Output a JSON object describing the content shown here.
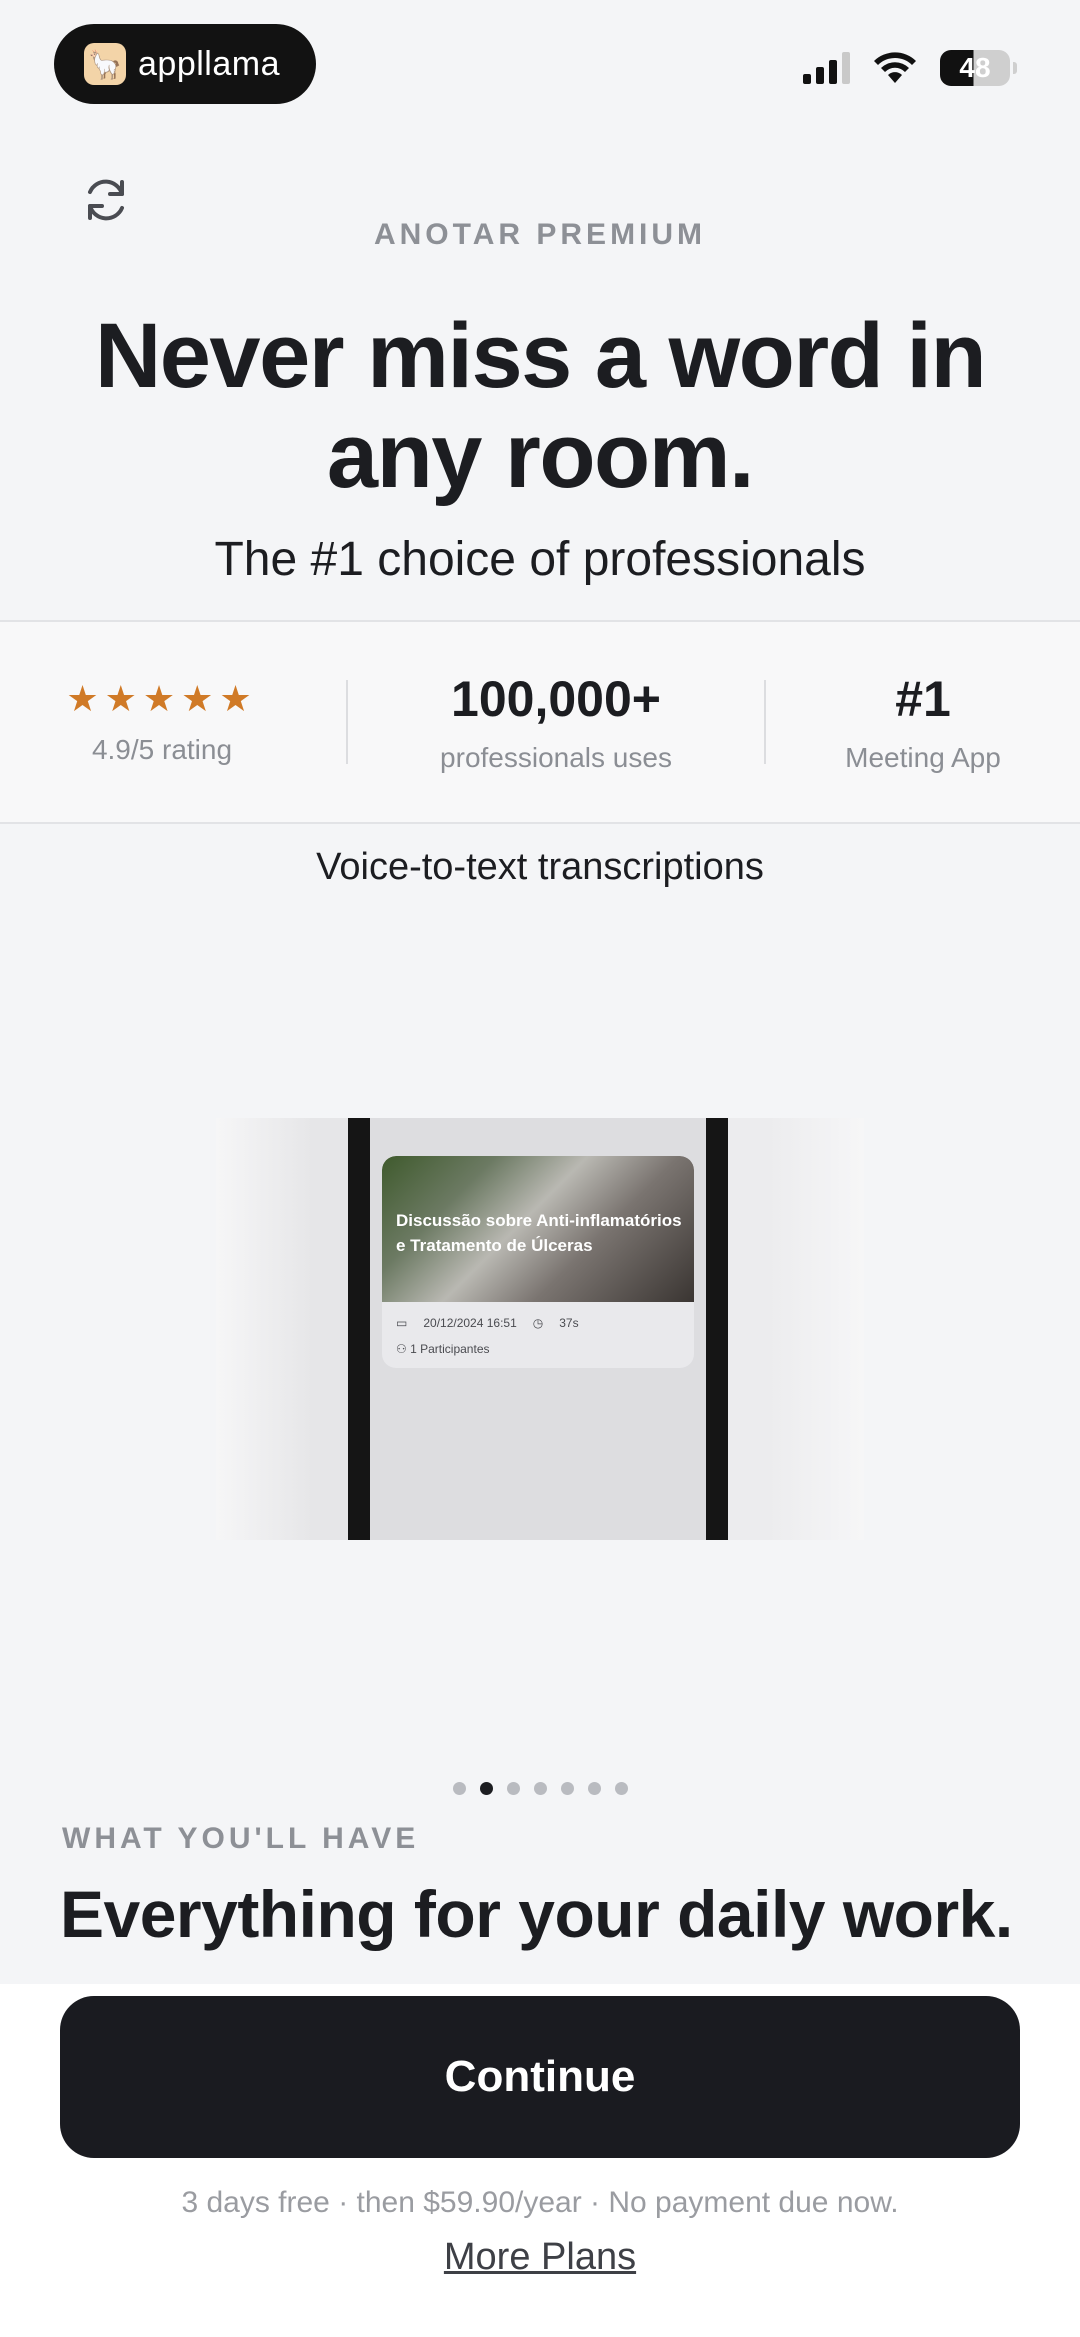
{
  "status_bar": {
    "brand_name": "appllama",
    "battery": "48",
    "icons": [
      "signal-icon",
      "wifi-icon",
      "battery-icon"
    ]
  },
  "header": {
    "restore_icon": "refresh-icon",
    "eyebrow": "ANOTAR PREMIUM",
    "headline": "Never miss a word in any room.",
    "subheadline": "The #1 choice of professionals"
  },
  "stats": {
    "rating_stars": "★★★★★",
    "rating_value": 4.9,
    "rating_label": "4.9/5 rating",
    "users_value": "100,000+",
    "users_label": "professionals uses",
    "rank_value": "#1",
    "rank_label": "Meeting App",
    "star_color": "#d07a27"
  },
  "feature": {
    "caption": "Voice-to-text transcriptions",
    "preview": {
      "title": "Discussão sobre Anti-inflamatórios e Tratamento de Úlceras",
      "date": "20/12/2024 16:51",
      "duration": "37s",
      "participants": "1 Participantes"
    }
  },
  "pager": {
    "count": 7,
    "active_index": 1
  },
  "section": {
    "eyebrow": "WHAT YOU'LL HAVE",
    "title": "Everything for your daily work."
  },
  "footer": {
    "cta_label": "Continue",
    "terms": "3 days free · then $59.90/year · No payment due now.",
    "more_plans": "More Plans",
    "cta_color": "#1a1b20"
  }
}
